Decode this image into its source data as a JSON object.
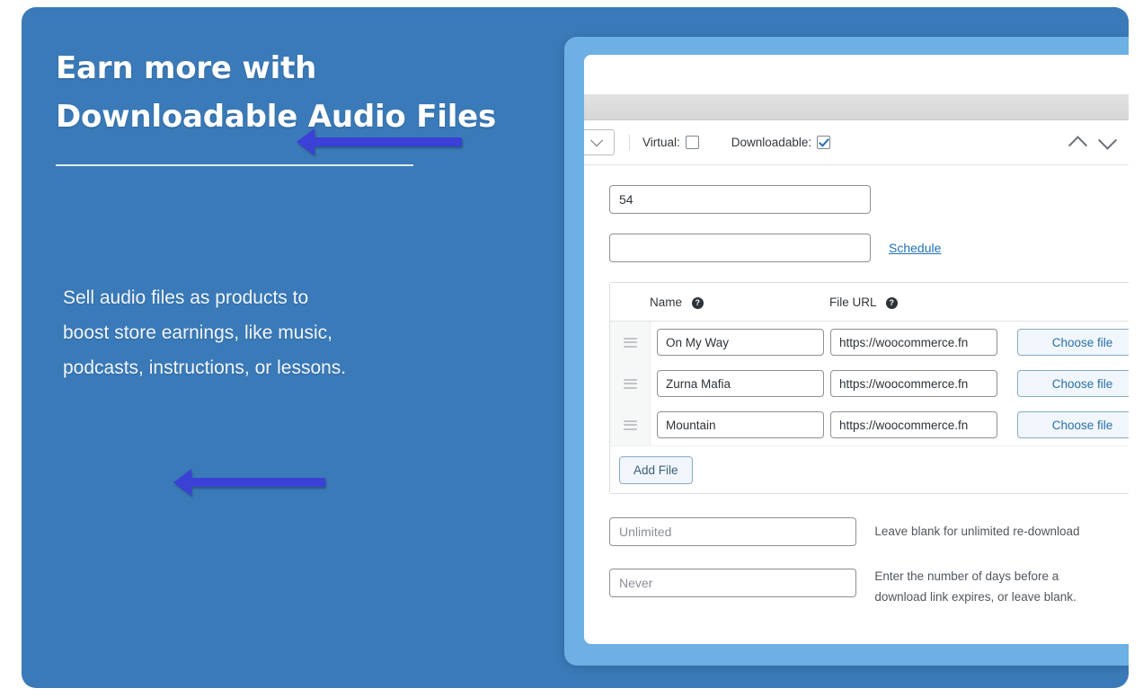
{
  "promo": {
    "title_line1": "Earn more with",
    "title_line2": "Downloadable Audio Files",
    "body_line1": "Sell audio files as products to",
    "body_line2": "boost store earnings, like music,",
    "body_line3": "podcasts, instructions, or lessons.",
    "background_color": "#3a7ab8",
    "accent_color": "#3b40d6"
  },
  "screenshot": {
    "toolbar": {
      "virtual_label": "Virtual:",
      "virtual_checked": false,
      "downloadable_label": "Downloadable:",
      "downloadable_checked": true
    },
    "price_fields": {
      "regular_price_value": "54",
      "sale_price_value": "",
      "schedule_link": "Schedule"
    },
    "files_table": {
      "col_name": "Name",
      "col_url": "File URL",
      "help_glyph": "?",
      "rows": [
        {
          "name": "On My Way",
          "url": "https://woocommerce.fn",
          "button": "Choose file"
        },
        {
          "name": "Zurna Mafia",
          "url": "https://woocommerce.fn",
          "button": "Choose file"
        },
        {
          "name": "Mountain",
          "url": "https://woocommerce.fn",
          "button": "Choose file"
        }
      ],
      "add_file_label": "Add File"
    },
    "limits": {
      "download_limit_placeholder": "Unlimited",
      "download_limit_help": "Leave blank for unlimited re-download",
      "expiry_placeholder": "Never",
      "expiry_help_line1": "Enter the number of days before a",
      "expiry_help_line2": "download link expires, or leave blank."
    }
  }
}
